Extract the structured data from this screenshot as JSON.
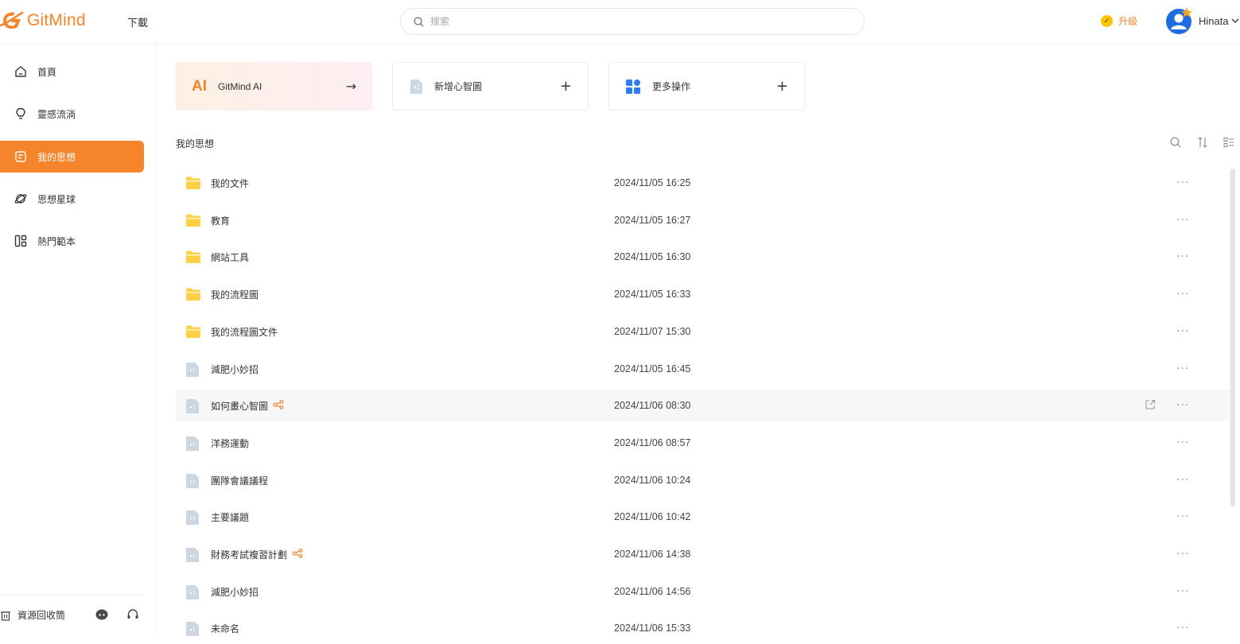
{
  "app": {
    "logo_text": "GitMind",
    "download_label": "下載",
    "search_placeholder": "搜索",
    "upgrade_label": "升級",
    "username": "Hinata"
  },
  "colors": {
    "accent": "#f6842a",
    "folder": "#ffcf45",
    "file": "#cdd6e3"
  },
  "sidebar": {
    "items": [
      {
        "label": "首頁",
        "icon": "home-icon",
        "active": false
      },
      {
        "label": "靈感流淌",
        "icon": "lightbulb-icon",
        "active": false
      },
      {
        "label": "我的思想",
        "icon": "document-icon",
        "active": true
      },
      {
        "label": "思想星球",
        "icon": "planet-icon",
        "active": false
      },
      {
        "label": "熱門範本",
        "icon": "template-icon",
        "active": false
      }
    ],
    "recycle_label": "資源回收筒"
  },
  "actions": {
    "ai_mark": "AI",
    "ai_label": "GitMind AI",
    "new_label": "新增心智圖",
    "more_label": "更多操作",
    "plus": "+",
    "arrow": "→"
  },
  "section_title": "我的思想",
  "files": [
    {
      "name": "我的文件",
      "date": "2024/11/05 16:25",
      "type": "folder",
      "shared": false
    },
    {
      "name": "教育",
      "date": "2024/11/05 16:27",
      "type": "folder",
      "shared": false
    },
    {
      "name": "網站工具",
      "date": "2024/11/05 16:30",
      "type": "folder",
      "shared": false
    },
    {
      "name": "我的流程圖",
      "date": "2024/11/05 16:33",
      "type": "folder",
      "shared": false
    },
    {
      "name": "我的流程圖文件",
      "date": "2024/11/07 15:30",
      "type": "folder",
      "shared": false
    },
    {
      "name": "減肥小妙招",
      "date": "2024/11/05 16:45",
      "type": "file",
      "shared": false
    },
    {
      "name": "如何畫心智圖",
      "date": "2024/11/06 08:30",
      "type": "file",
      "shared": true,
      "hover": true
    },
    {
      "name": "洋務運動",
      "date": "2024/11/06 08:57",
      "type": "file",
      "shared": false
    },
    {
      "name": "團隊會議議程",
      "date": "2024/11/06 10:24",
      "type": "file",
      "shared": false
    },
    {
      "name": "主要議題",
      "date": "2024/11/06 10:42",
      "type": "file",
      "shared": false
    },
    {
      "name": "財務考試複習計劃",
      "date": "2024/11/06 14:38",
      "type": "file",
      "shared": true
    },
    {
      "name": "減肥小妙招",
      "date": "2024/11/06 14:56",
      "type": "file",
      "shared": false
    },
    {
      "name": "未命名",
      "date": "2024/11/06 15:33",
      "type": "file",
      "shared": false
    }
  ],
  "more_glyph": "···"
}
